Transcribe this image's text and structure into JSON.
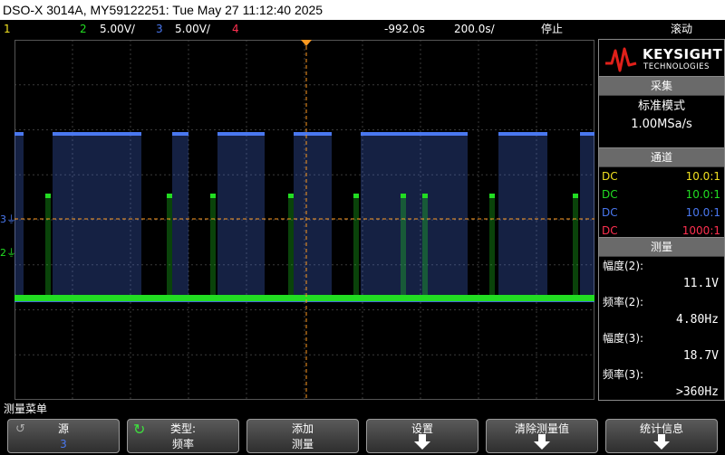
{
  "title": "DSO-X 3014A, MY59122251: Tue May 27 11:12:40 2025",
  "status": {
    "ch1": "1",
    "ch2": "2",
    "ch2_scale": "5.00V/",
    "ch3": "3",
    "ch3_scale": "5.00V/",
    "ch4": "4",
    "delay": "-992.0s",
    "timebase": "200.0s/",
    "run_state": "停止",
    "mode": "滚动"
  },
  "colors": {
    "ch1": "#f0e020",
    "ch2": "#22dd22",
    "ch3": "#4a78f0",
    "ch4": "#ff3050",
    "trigger": "#ff9a20",
    "grid": "#3a3a3a"
  },
  "logo": {
    "brand": "KEYSIGHT",
    "sub": "TECHNOLOGIES"
  },
  "acquire": {
    "header": "采集",
    "mode": "标准模式",
    "rate": "1.00MSa/s"
  },
  "channels": {
    "header": "通道",
    "rows": [
      {
        "coupling": "DC",
        "probe": "10.0:1"
      },
      {
        "coupling": "DC",
        "probe": "10.0:1"
      },
      {
        "coupling": "DC",
        "probe": "10.0:1"
      },
      {
        "coupling": "DC",
        "probe": "1000:1"
      }
    ]
  },
  "measure": {
    "header": "测量",
    "items": [
      {
        "label": "幅度(2):",
        "value": "11.1V"
      },
      {
        "label": "频率(2):",
        "value": "4.80Hz"
      },
      {
        "label": "幅度(3):",
        "value": "18.7V"
      },
      {
        "label": "频率(3):",
        "value": ">360Hz"
      }
    ]
  },
  "markers": {
    "ch3": "3",
    "ch2": "2"
  },
  "menu_title": "测量菜单",
  "softkeys": [
    {
      "line1": "源",
      "line2": "3"
    },
    {
      "line1": "类型:",
      "line2": "频率"
    },
    {
      "line1": "添加",
      "line2": "测量"
    },
    {
      "line1": "设置",
      "line2": ""
    },
    {
      "line1": "清除测量值",
      "line2": ""
    },
    {
      "line1": "统计信息",
      "line2": ""
    }
  ]
}
